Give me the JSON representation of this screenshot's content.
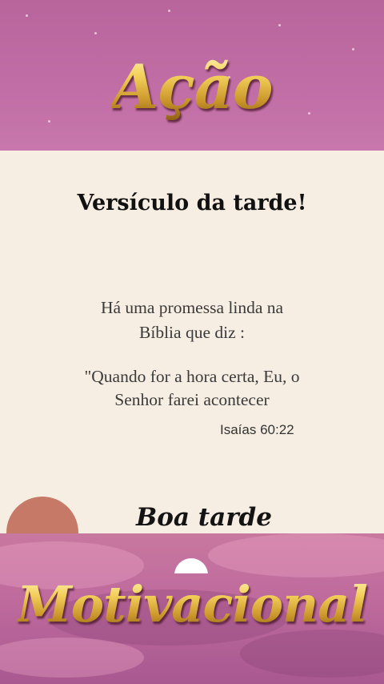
{
  "header": {
    "title": "Ação"
  },
  "card": {
    "heading": "Versículo da tarde!",
    "lines": [
      "Há uma promessa linda na",
      "Bíblia que diz :",
      "\"Quando for a hora certa, Eu, o",
      "Senhor farei acontecer"
    ],
    "reference": "Isaías 60:22",
    "greeting": "Boa tarde"
  },
  "footer": {
    "title": "Motivacional"
  },
  "colors": {
    "band": "#c06ea5",
    "card": "#f7eee3",
    "gold": "#e6b842",
    "sun": "#c77967"
  }
}
